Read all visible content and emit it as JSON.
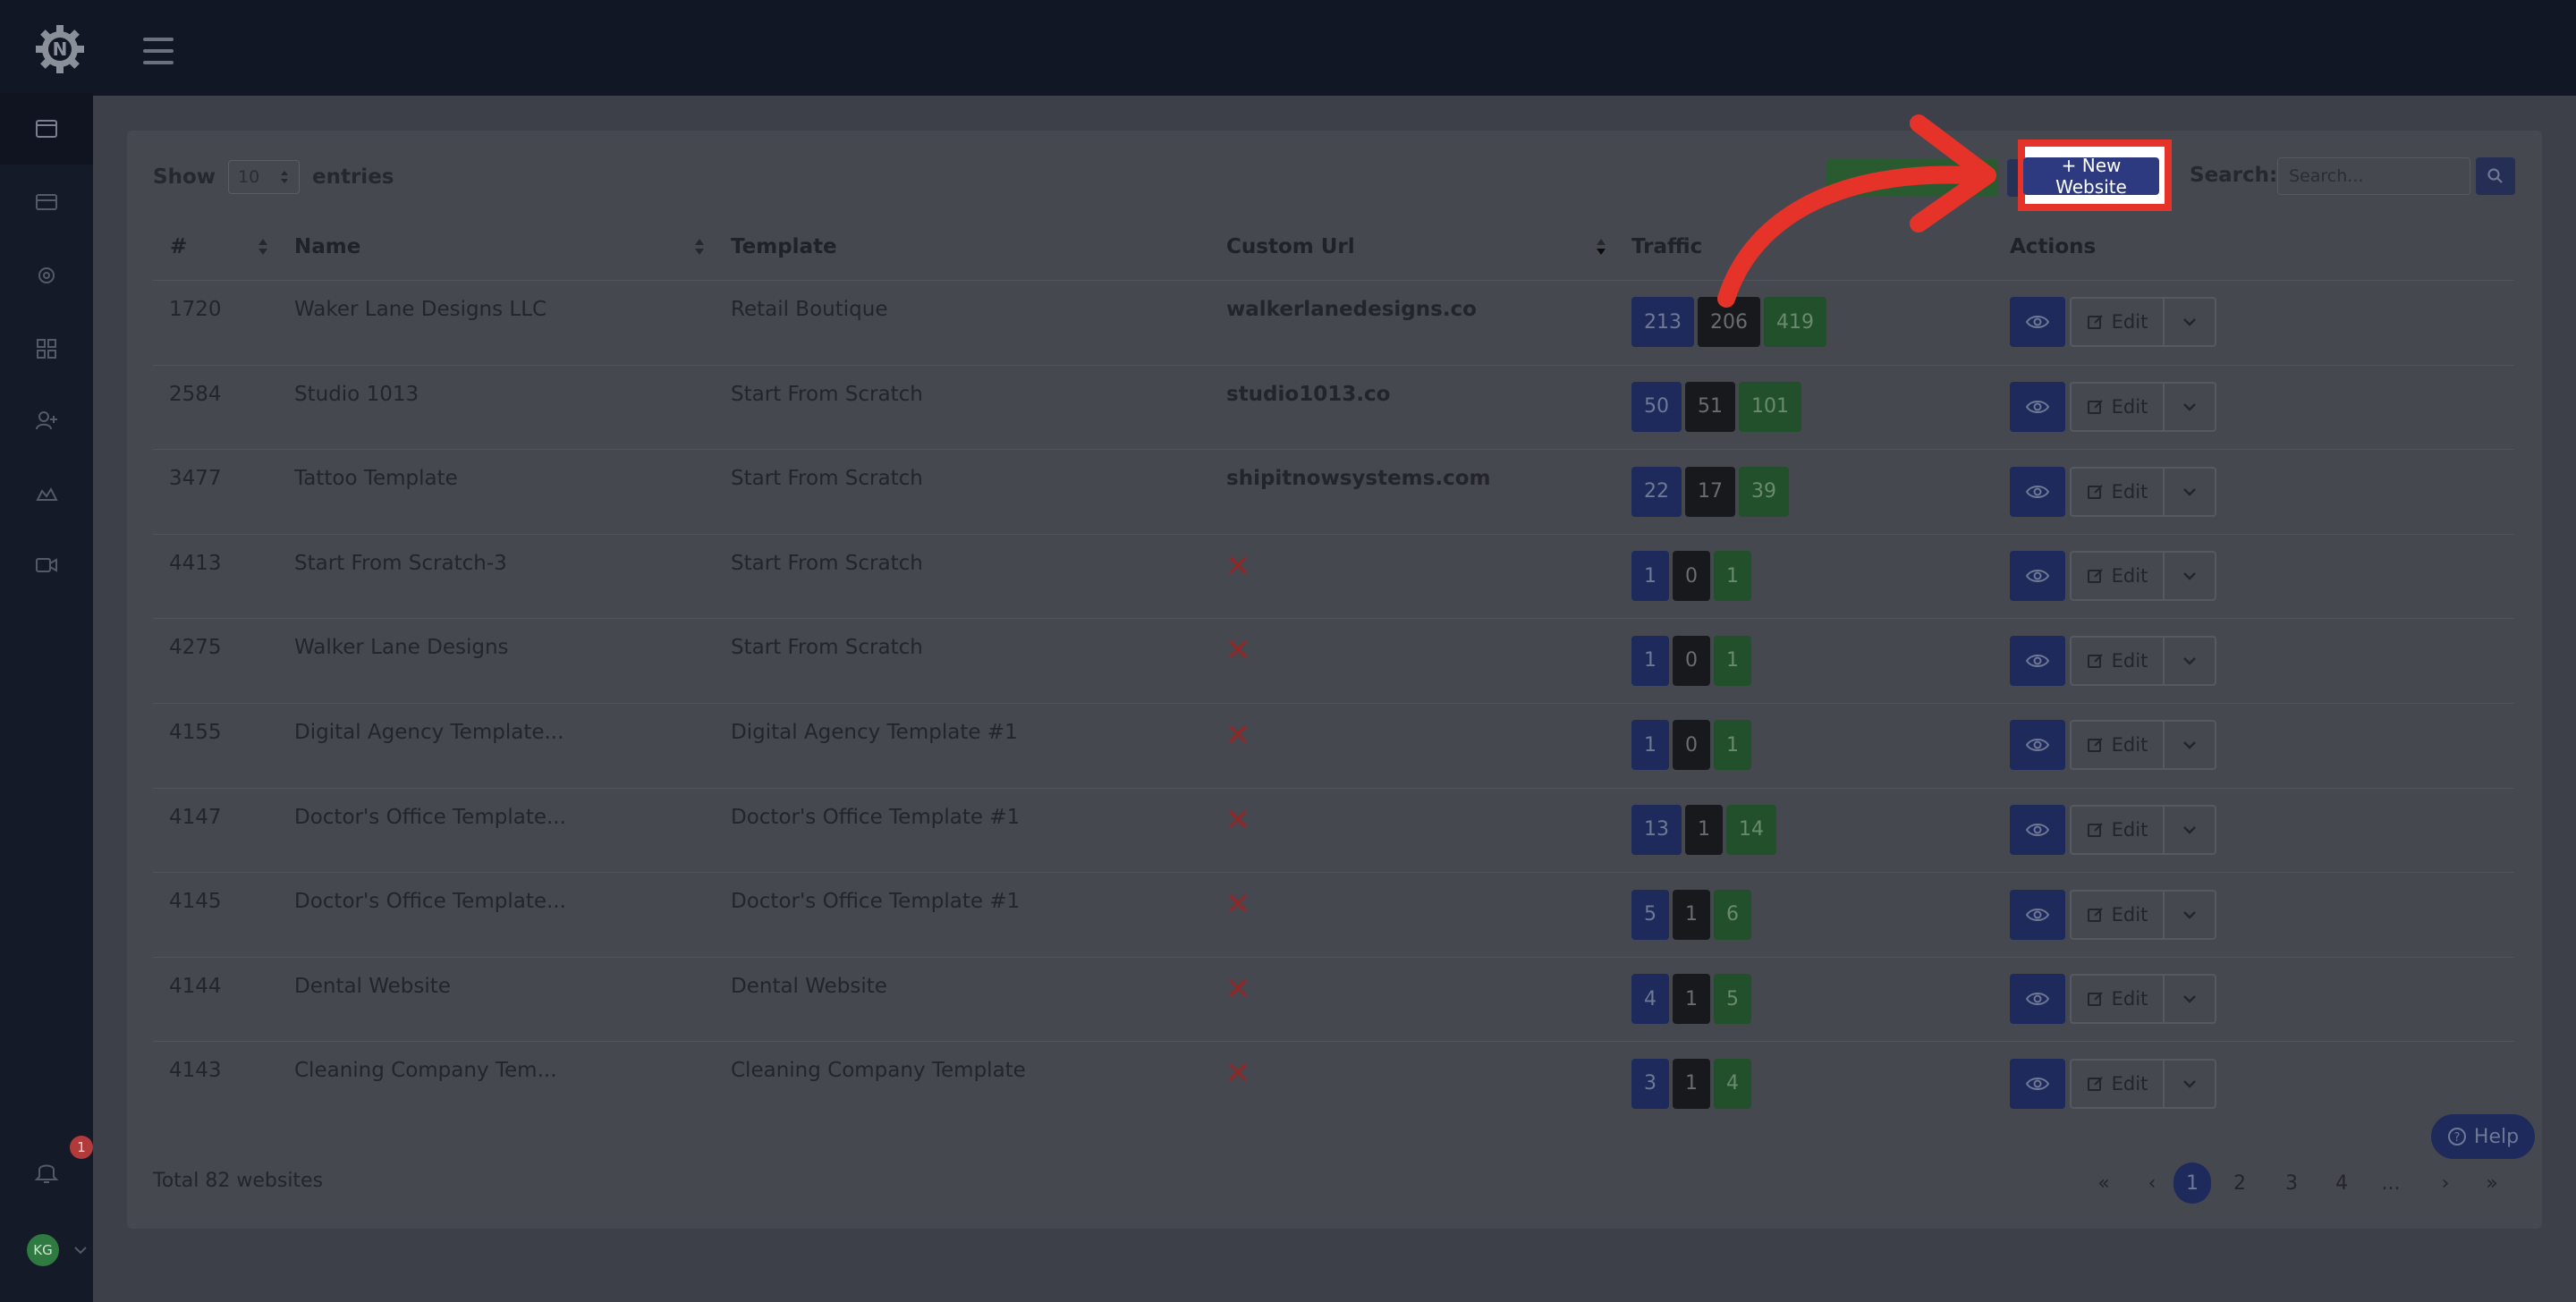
{
  "app": {
    "sidebar_icons": [
      "browser-icon",
      "card-icon",
      "gear-icon",
      "apps-icon",
      "add-user-icon",
      "cloud-icon",
      "video-icon"
    ],
    "notification_count": "1",
    "user_initials": "KG"
  },
  "toolbar": {
    "show_label": "Show",
    "entries_value": "10",
    "entries_label": "entries",
    "new_website_label": "+ New Website",
    "search_label": "Search:",
    "search_placeholder": "Search..."
  },
  "table": {
    "headers": [
      "#",
      "Name",
      "Template",
      "Custom Url",
      "Traffic",
      "Actions"
    ],
    "edit_label": "Edit",
    "rows": [
      {
        "id": "1720",
        "name": "Waker Lane Designs LLC",
        "template": "Retail Boutique",
        "url": "walkerlanedesigns.co",
        "traffic": [
          "213",
          "206",
          "419"
        ]
      },
      {
        "id": "2584",
        "name": "Studio 1013",
        "template": "Start From Scratch",
        "url": "studio1013.co",
        "traffic": [
          "50",
          "51",
          "101"
        ]
      },
      {
        "id": "3477",
        "name": "Tattoo Template",
        "template": "Start From Scratch",
        "url": "shipitnowsystems.com",
        "traffic": [
          "22",
          "17",
          "39"
        ]
      },
      {
        "id": "4413",
        "name": "Start From Scratch-3",
        "template": "Start From Scratch",
        "url": "",
        "traffic": [
          "1",
          "0",
          "1"
        ]
      },
      {
        "id": "4275",
        "name": "Walker Lane Designs",
        "template": "Start From Scratch",
        "url": "",
        "traffic": [
          "1",
          "0",
          "1"
        ]
      },
      {
        "id": "4155",
        "name": "Digital Agency Template...",
        "template": "Digital Agency Template #1",
        "url": "",
        "traffic": [
          "1",
          "0",
          "1"
        ]
      },
      {
        "id": "4147",
        "name": "Doctor's Office Template...",
        "template": "Doctor's Office Template #1",
        "url": "",
        "traffic": [
          "13",
          "1",
          "14"
        ]
      },
      {
        "id": "4145",
        "name": "Doctor's Office Template...",
        "template": "Doctor's Office Template #1",
        "url": "",
        "traffic": [
          "5",
          "1",
          "6"
        ]
      },
      {
        "id": "4144",
        "name": "Dental Website",
        "template": "Dental Website",
        "url": "",
        "traffic": [
          "4",
          "1",
          "5"
        ]
      },
      {
        "id": "4143",
        "name": "Cleaning Company Tem...",
        "template": "Cleaning Company Template",
        "url": "",
        "traffic": [
          "3",
          "1",
          "4"
        ]
      }
    ]
  },
  "footer": {
    "total": "Total 82 websites",
    "pagination": [
      "«",
      "‹",
      "1",
      "2",
      "3",
      "4",
      "...",
      "›",
      "»"
    ],
    "active_page": "1"
  },
  "help": {
    "label": "Help"
  },
  "colors": {
    "annotation": "#e53329",
    "primary": "#2d3a80",
    "success": "#2f7a40"
  }
}
